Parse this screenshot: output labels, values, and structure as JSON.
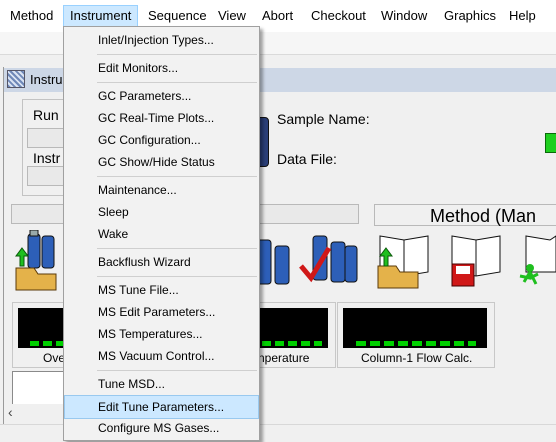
{
  "menubar": {
    "items": [
      {
        "label": "Method"
      },
      {
        "label": "Instrument"
      },
      {
        "label": "Sequence"
      },
      {
        "label": "View"
      },
      {
        "label": "Abort"
      },
      {
        "label": "Checkout"
      },
      {
        "label": "Window"
      },
      {
        "label": "Graphics"
      },
      {
        "label": "Help"
      }
    ],
    "active": "Instrument"
  },
  "window": {
    "title_fragment": "Instru",
    "run_label_fragment": "Run",
    "instr_label_fragment": "Instr",
    "sample_name_label": "Sample Name:",
    "data_file_label": "Data File:",
    "method_label_fragment": "Method (Man"
  },
  "gauges": [
    {
      "label_fragment": "Ove"
    },
    {
      "label_fragment": "nperature"
    },
    {
      "label": "Column-1 Flow Calc."
    }
  ],
  "dropdown": {
    "groups": [
      [
        "Inlet/Injection Types..."
      ],
      [
        "Edit Monitors..."
      ],
      [
        "GC Parameters...",
        "GC Real-Time Plots...",
        "GC Configuration...",
        "GC Show/Hide Status"
      ],
      [
        "Maintenance...",
        "Sleep",
        "Wake"
      ],
      [
        "Backflush Wizard"
      ],
      [
        "MS Tune File...",
        "MS Edit Parameters...",
        "MS Temperatures...",
        "MS Vacuum Control..."
      ],
      [
        "Tune MSD...",
        "Edit Tune Parameters...",
        "Configure MS Gases..."
      ]
    ],
    "highlighted": "Edit Tune Parameters..."
  },
  "colors": {
    "menu_highlight": "#cce8ff",
    "led_green": "#00d000",
    "screen_black": "#000000"
  },
  "icons": [
    "load-method-icon",
    "save-method-icon",
    "run-method-icon",
    "vials-icon",
    "vials-check-icon",
    "scroll-left-icon"
  ]
}
